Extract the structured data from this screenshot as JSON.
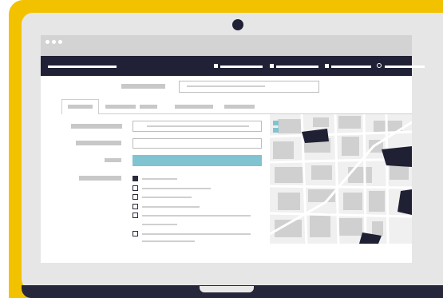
{
  "colors": {
    "frame": "#f2c200",
    "laptop_bezel": "#e6e6e6",
    "navbar": "#202136",
    "submit_button": "#7fc4d0",
    "map_block": "#1f2033"
  },
  "icons": {
    "window_dots": "three-dots-icon",
    "nav_icons": "square-icon",
    "map_zoom": "plus-minus-icon"
  },
  "tabs": [
    {
      "active": true
    },
    {
      "active": false
    },
    {
      "active": false
    },
    {
      "active": false
    }
  ],
  "checklist": [
    {
      "checked": true
    },
    {
      "checked": false
    },
    {
      "checked": false
    },
    {
      "checked": false
    },
    {
      "checked": false
    },
    {
      "checked": false
    }
  ]
}
